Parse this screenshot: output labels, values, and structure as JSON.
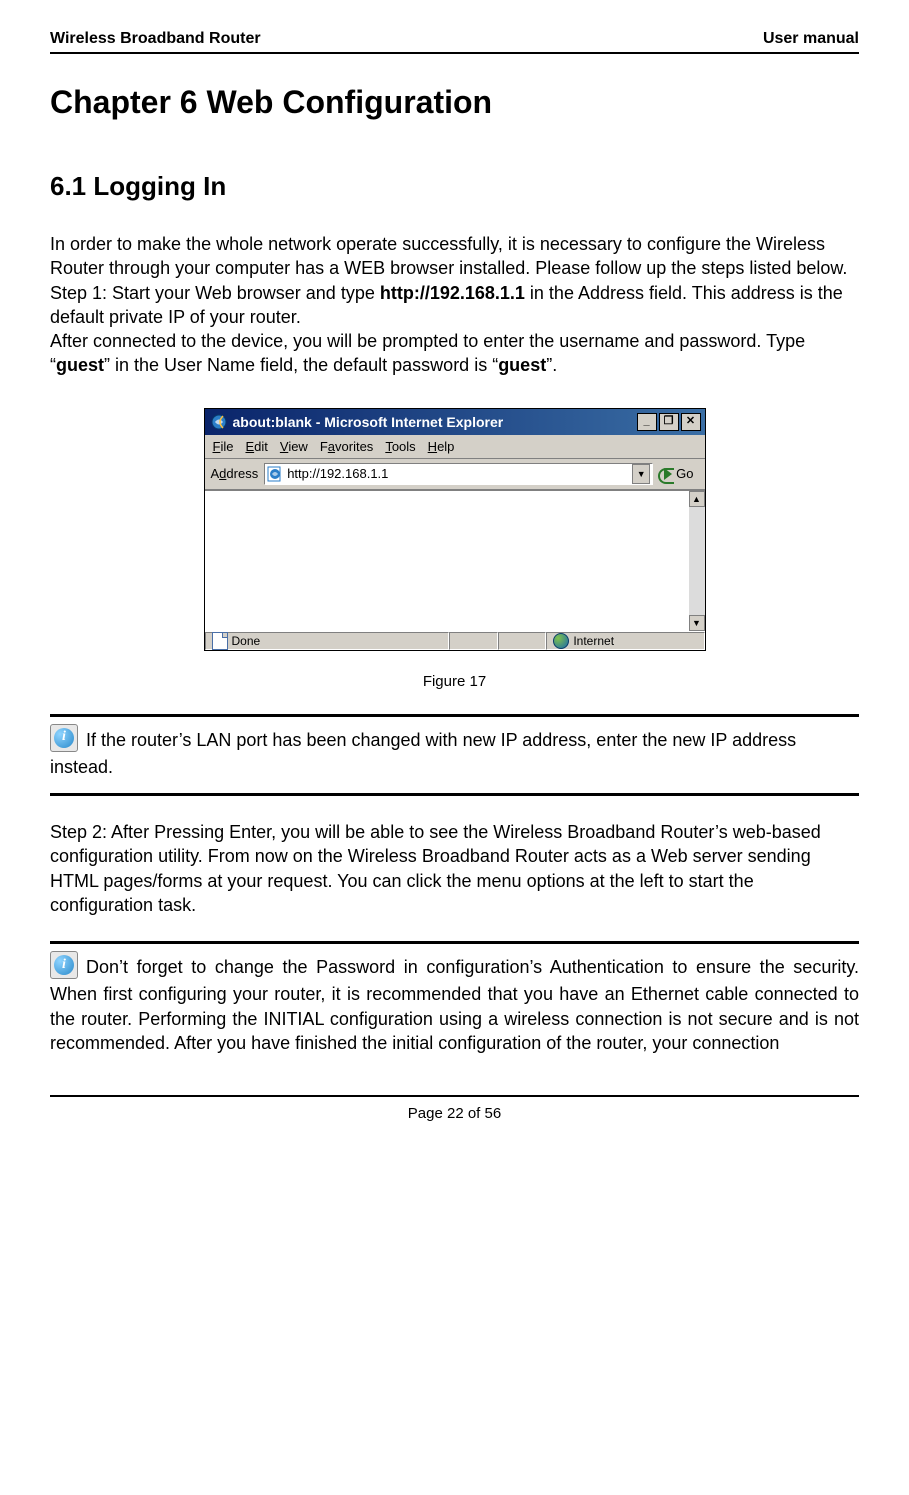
{
  "header": {
    "left": "Wireless Broadband Router",
    "right": "User manual"
  },
  "chapter_title": "Chapter 6 Web Configuration",
  "section_title": "6.1 Logging In",
  "intro": {
    "p1": "In order to make the whole network operate successfully, it is necessary to configure the Wireless Router through your computer has a WEB browser installed. Please follow up the steps listed below.",
    "step1_prefix": "Step 1: Start your Web browser and type ",
    "step1_bold": "http://192.168.1.1",
    "step1_suffix": " in the Address field. This address is the default private IP of your router.",
    "after_connect_prefix": "After connected to the device, you will be prompted to enter the username and password. Type “",
    "after_connect_bold1": "guest",
    "after_connect_mid": "” in the User Name field, the default password is “",
    "after_connect_bold2": "guest",
    "after_connect_suffix": "”."
  },
  "ie": {
    "title": "about:blank - Microsoft Internet Explorer",
    "menu": {
      "file": "File",
      "edit": "Edit",
      "view": "View",
      "favorites": "Favorites",
      "tools": "Tools",
      "help": "Help"
    },
    "address_label": "Address",
    "address_value": "http://192.168.1.1",
    "go": "Go",
    "status_done": "Done",
    "status_zone": "Internet",
    "min_glyph": "_",
    "restore_glyph": "❐",
    "close_glyph": "✕",
    "dropdown_glyph": "▼",
    "scroll_up_glyph": "▲",
    "scroll_down_glyph": "▼"
  },
  "figure_caption": "Figure 17",
  "note1": "If the router’s LAN port has been changed with new IP address, enter the new IP address instead.",
  "step2": "Step 2: After Pressing Enter, you will be able to see the Wireless Broadband Router’s web-based configuration utility. From now on the Wireless Broadband Router acts as a Web server sending HTML pages/forms at your request. You can click the menu options at the left to start the configuration task.",
  "note2": "Don’t forget to change the Password in configuration’s Authentication to ensure the security. When first configuring your router, it is recommended that you have an Ethernet cable connected to the router. Performing the INITIAL configuration using a wireless connection is not secure and is not recommended. After you have finished the initial configuration of the router, your connection",
  "footer": "Page 22 of 56",
  "info_glyph": "i"
}
